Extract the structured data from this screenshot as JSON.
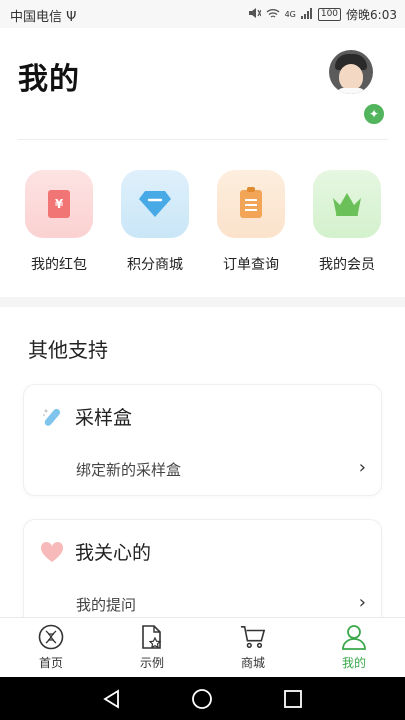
{
  "statusbar": {
    "carrier": "中国电信",
    "usb": "Ψ",
    "network": "4G",
    "battery": "100",
    "time": "傍晚6:03"
  },
  "header": {
    "title": "我的"
  },
  "quick": [
    {
      "label": "我的红包",
      "icon": "red-packet-icon"
    },
    {
      "label": "积分商城",
      "icon": "diamond-icon"
    },
    {
      "label": "订单查询",
      "icon": "clipboard-icon"
    },
    {
      "label": "我的会员",
      "icon": "crown-icon"
    }
  ],
  "support": {
    "title": "其他支持",
    "cards": [
      {
        "title": "采样盒",
        "row": "绑定新的采样盒",
        "icon": "test-tube-icon"
      },
      {
        "title": "我关心的",
        "row": "我的提问",
        "icon": "heart-icon"
      }
    ]
  },
  "nav": [
    {
      "label": "首页",
      "icon": "dna-icon"
    },
    {
      "label": "示例",
      "icon": "document-star-icon"
    },
    {
      "label": "商城",
      "icon": "cart-icon"
    },
    {
      "label": "我的",
      "icon": "person-icon",
      "active": true
    }
  ],
  "colors": {
    "accent": "#3aa84a",
    "background": "#ffffff",
    "separator": "#f4f4f4"
  }
}
